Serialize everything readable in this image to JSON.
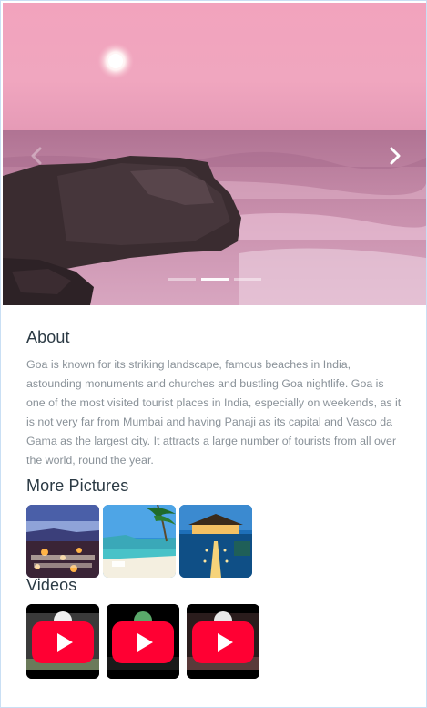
{
  "hero": {
    "slide_count": 3,
    "active_slide": 2,
    "prev_icon": "chevron-left-icon",
    "next_icon": "chevron-right-icon"
  },
  "about": {
    "title": "About",
    "text": "Goa is known for its striking landscape, famous beaches in India, astounding monuments and churches and bustling Goa nightlife. Goa is one of the most visited tourist places in India, especially on weekends, as it is not very far from Mumbai and having Panaji as its capital and Vasco da Gama as the largest city. It attracts a large number of tourists from all over the world, round the year."
  },
  "pictures": {
    "title": "More Pictures"
  },
  "videos": {
    "title": "Videos",
    "play_icon": "youtube-play-icon"
  },
  "colors": {
    "heading": "#2b3a44",
    "body_text": "#8a9299",
    "youtube_red": "#ff0033",
    "border": "#c9dff4"
  }
}
